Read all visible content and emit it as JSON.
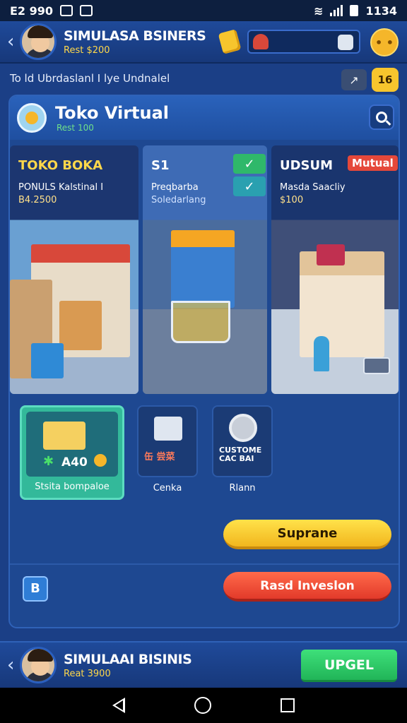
{
  "status_bar": {
    "left_text": "E2 990",
    "right_text": "1134"
  },
  "header": {
    "title": "SIMULASA BSINERS",
    "subtitle": "Rest $200"
  },
  "subheader": {
    "text": "To ld Ubrdaslanl I lye Undnalel",
    "badge": "16"
  },
  "panel": {
    "title": "Toko Virtual",
    "subtitle": "Rest 100",
    "cards": [
      {
        "title": "TOKO BOKA",
        "line1": "PONULS Kalstinal  I",
        "line2": "B4.2500"
      },
      {
        "title": "S1",
        "line1": "Preqbarba",
        "line2": "Soledarlang"
      },
      {
        "title": "UDSUM",
        "tag": "Mutual",
        "line1": "Masda Saacliy",
        "line2": "$100"
      }
    ],
    "items": [
      {
        "label": "Stsita bompaloe",
        "amount": "A40"
      },
      {
        "label": "Cenka",
        "code": "缶 尝菜"
      },
      {
        "label": "Rlann",
        "code": "CUSTOME CAC BAI"
      }
    ],
    "upgrade_button": "Suprane",
    "invest_button": "Rasd Inveslon",
    "b_icon": "B"
  },
  "bottom_bar": {
    "title": "SIMULAAI BISINIS",
    "subtitle": "Reat 3900",
    "button": "UPGEL"
  },
  "colors": {
    "background": "#1b3f86",
    "accent_yellow": "#f7c52d",
    "accent_red": "#e23a2a",
    "accent_green": "#21b558"
  }
}
